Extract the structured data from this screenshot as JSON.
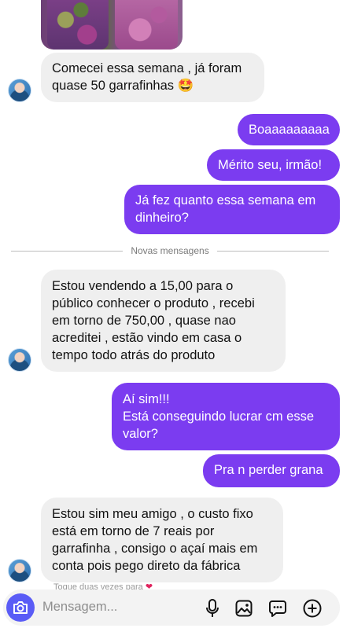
{
  "messages": [
    {
      "dir": "in",
      "text": "Comecei essa semana , já foram\nquase 50 garrafinhas 🤩"
    },
    {
      "dir": "out",
      "text": "Boaaaaaaaaa"
    },
    {
      "dir": "out",
      "text": "Mérito seu, irmão!"
    },
    {
      "dir": "out",
      "text": "Já fez quanto essa semana em\ndinheiro?"
    },
    {
      "dir": "in",
      "text": "Estou vendendo a 15,00 para o\npúblico conhecer o produto , recebi\nem torno de 750,00 , quase nao\nacreditei , estão vindo em casa o\ntempo todo atrás do produto"
    },
    {
      "dir": "out",
      "text": "Aí sim!!!\nEstá conseguindo lucrar cm esse\nvalor?"
    },
    {
      "dir": "out",
      "text": "Pra n perder grana"
    },
    {
      "dir": "in",
      "text": "Estou sim meu amigo , o custo fixo\nestá em torno de 7 reais por\ngarrafinha , consigo o açaí mais em\nconta pois pego direto da fábrica"
    }
  ],
  "divider_label": "Novas mensagens",
  "peek_text": "Toque duas vezes para",
  "composer": {
    "placeholder": "Mensagem..."
  },
  "icons": {
    "camera": "camera-icon",
    "mic": "microphone-icon",
    "gallery": "gallery-icon",
    "sticker": "sticker-icon",
    "add": "add-icon"
  },
  "colors": {
    "outgoing": "#7b3cf0",
    "incoming": "#efefef",
    "camera_button": "#5a5cf6"
  }
}
